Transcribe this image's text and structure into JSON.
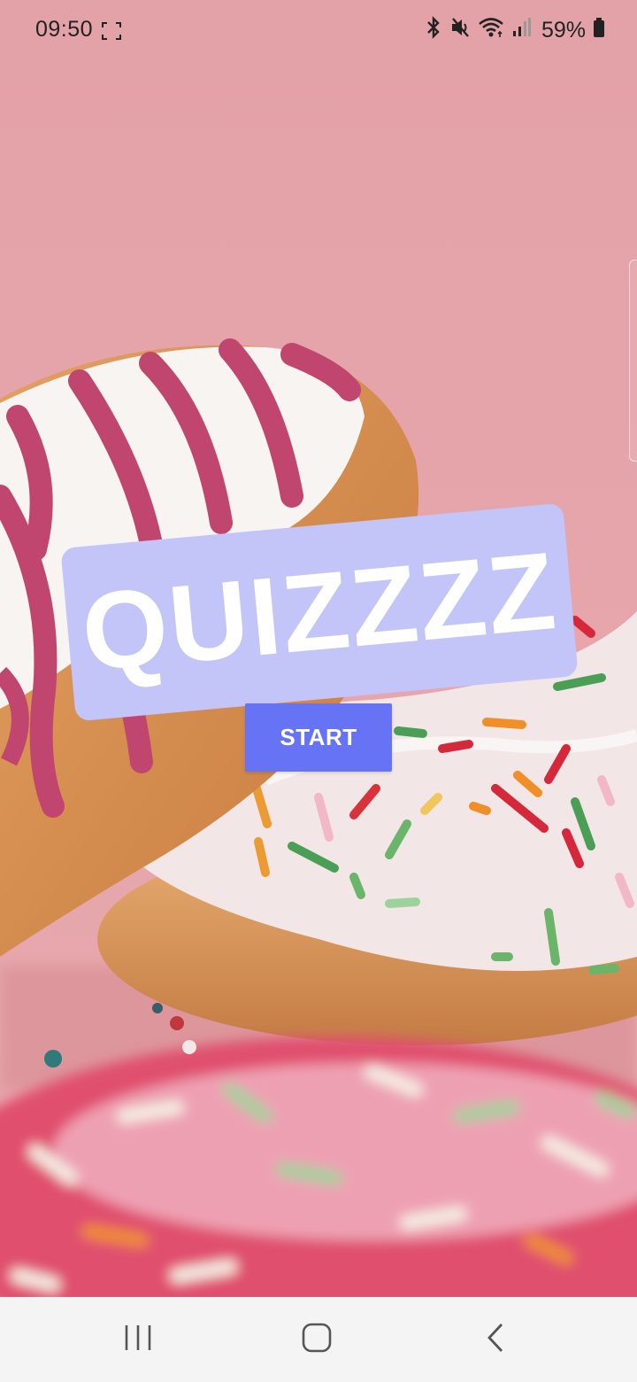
{
  "status_bar": {
    "time": "09:50",
    "battery": "59%",
    "icons": [
      "screenshot-frame-icon",
      "bluetooth-icon",
      "mute-icon",
      "wifi-icon",
      "signal-icon",
      "battery-icon"
    ]
  },
  "app": {
    "title": "QUIZZZZ",
    "start_label": "START",
    "colors": {
      "title_card": "#c3c4f7",
      "start_button": "#6673f5",
      "background": "#e3a5ab"
    }
  },
  "nav_bar": {
    "buttons": [
      "recents-icon",
      "home-icon",
      "back-icon"
    ]
  }
}
